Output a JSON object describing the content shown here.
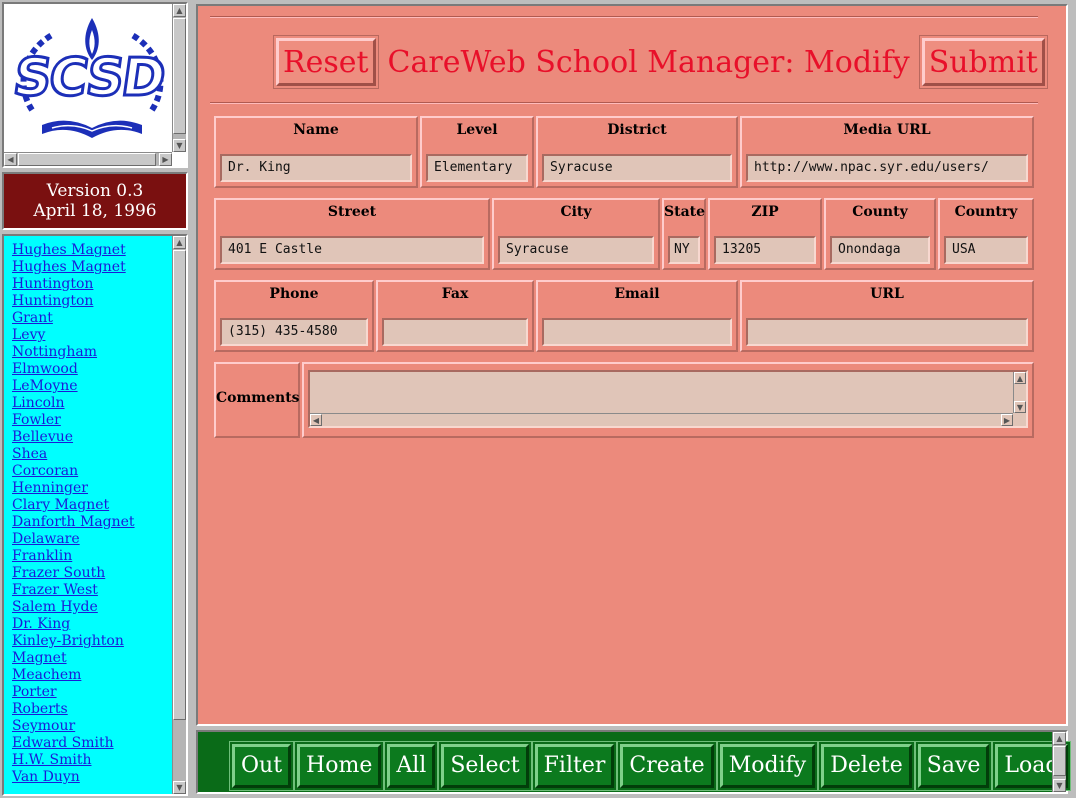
{
  "logo": {
    "text": "SCSD",
    "icon": "scsd-logo"
  },
  "version": {
    "line1": "Version 0.3",
    "line2": "April 18, 1996"
  },
  "schools": [
    "Hughes Magnet",
    "Hughes Magnet",
    "Huntington",
    "Huntington",
    "Grant",
    "Levy",
    "Nottingham",
    "Elmwood",
    "LeMoyne",
    "Lincoln",
    "Fowler",
    "Bellevue",
    "Shea",
    "Corcoran",
    "Henninger",
    "Clary Magnet",
    "Danforth Magnet",
    "Delaware",
    "Franklin",
    "Frazer South",
    "Frazer West",
    "Salem Hyde",
    "Dr. King",
    "Kinley-Brighton",
    "Magnet",
    "Meachem",
    "Porter",
    "Roberts",
    "Seymour",
    "Edward Smith",
    "H.W. Smith",
    "Van Duyn"
  ],
  "header": {
    "reset_label": "Reset",
    "title": "CareWeb School Manager: Modify",
    "submit_label": "Submit"
  },
  "form": {
    "name": {
      "label": "Name",
      "value": "Dr. King"
    },
    "level": {
      "label": "Level",
      "value": "Elementary"
    },
    "district": {
      "label": "District",
      "value": "Syracuse"
    },
    "media_url": {
      "label": "Media URL",
      "value": "http://www.npac.syr.edu/users/"
    },
    "street": {
      "label": "Street",
      "value": "401 E Castle"
    },
    "city": {
      "label": "City",
      "value": "Syracuse"
    },
    "state": {
      "label": "State",
      "value": "NY"
    },
    "zip": {
      "label": "ZIP",
      "value": "13205"
    },
    "county": {
      "label": "County",
      "value": "Onondaga"
    },
    "country": {
      "label": "Country",
      "value": "USA"
    },
    "phone": {
      "label": "Phone",
      "value": "(315) 435-4580"
    },
    "fax": {
      "label": "Fax",
      "value": ""
    },
    "email": {
      "label": "Email",
      "value": ""
    },
    "url": {
      "label": "URL",
      "value": ""
    },
    "comments": {
      "label": "Comments",
      "value": ""
    }
  },
  "nav": {
    "out": "Out",
    "home": "Home",
    "all": "All",
    "select": "Select",
    "filter": "Filter",
    "create": "Create",
    "modify": "Modify",
    "delete": "Delete",
    "save": "Save",
    "load": "Load"
  },
  "colors": {
    "main_bg": "#ec8a7c",
    "title_red": "#e8102a",
    "list_bg": "#00ffff",
    "version_bg": "#7a1010",
    "nav_bg": "#0a6b18",
    "link": "#1a1ad8"
  }
}
